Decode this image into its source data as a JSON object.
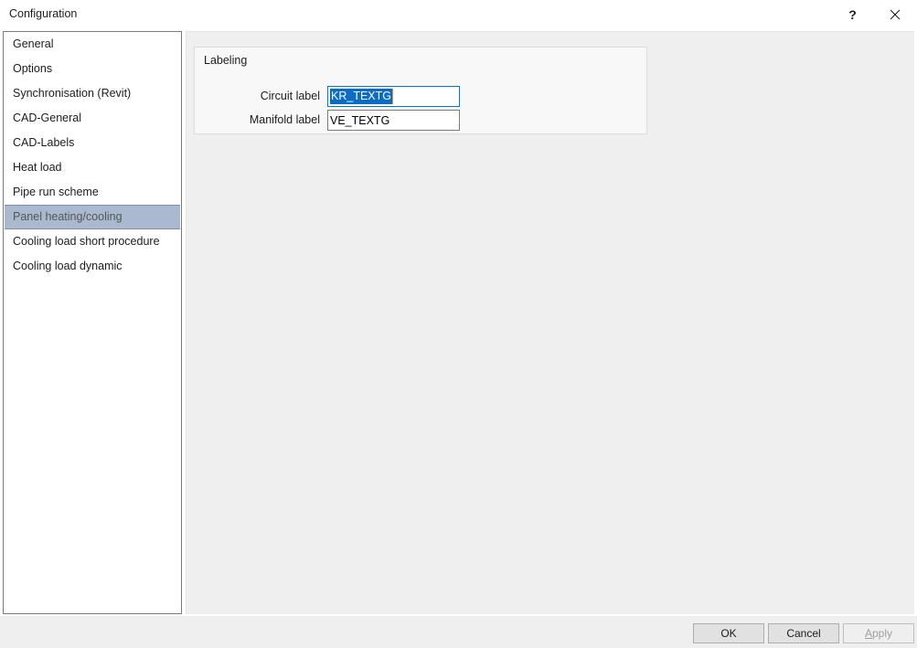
{
  "window": {
    "title": "Configuration",
    "help_icon": "question-mark-icon",
    "close_icon": "close-x-icon"
  },
  "sidebar": {
    "selected_index": 7,
    "items": [
      {
        "label": "General"
      },
      {
        "label": "Options"
      },
      {
        "label": "Synchronisation (Revit)"
      },
      {
        "label": "CAD-General"
      },
      {
        "label": "CAD-Labels"
      },
      {
        "label": "Heat load"
      },
      {
        "label": "Pipe run scheme"
      },
      {
        "label": "Panel heating/cooling"
      },
      {
        "label": "Cooling load short procedure"
      },
      {
        "label": "Cooling load dynamic"
      }
    ]
  },
  "main": {
    "group": {
      "title": "Labeling",
      "fields": [
        {
          "label": "Circuit label",
          "value": "KR_TEXTG",
          "focused": true,
          "selected": true
        },
        {
          "label": "Manifold label",
          "value": "VE_TEXTG",
          "focused": false,
          "selected": false
        }
      ]
    }
  },
  "footer": {
    "ok_label": "OK",
    "cancel_label": "Cancel",
    "apply_mnemonic": "A",
    "apply_rest": "pply",
    "apply_disabled": true
  },
  "colors": {
    "selection_highlight": "#0a6cc4",
    "focus_border": "#0078d7",
    "sidebar_selected_bg": "#aab8d0",
    "panel_bg": "#efefef",
    "group_bg": "#f8f8f8",
    "button_bg": "#e1e1e1"
  }
}
